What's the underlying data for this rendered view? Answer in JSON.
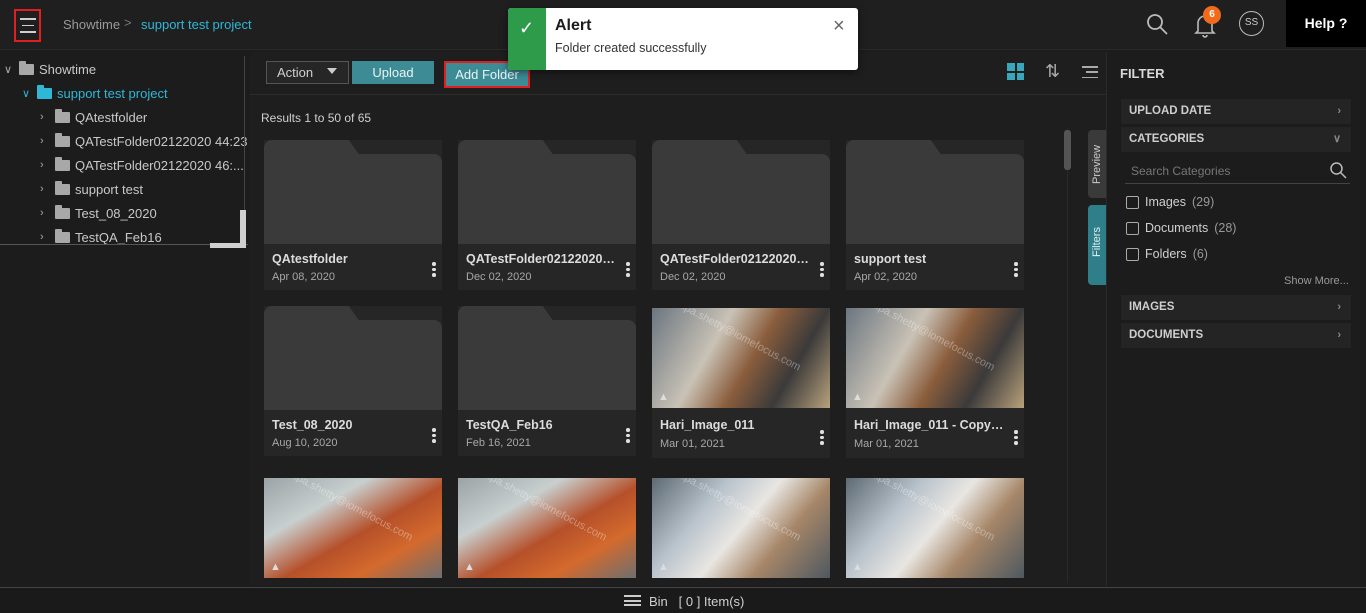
{
  "header": {
    "breadcrumb_root": "Showtime",
    "breadcrumb_sep": ">",
    "breadcrumb_current": "support test project",
    "notification_count": "6",
    "avatar_initials": "SS",
    "help_label": "Help ?"
  },
  "alert": {
    "title": "Alert",
    "message": "Folder created successfully",
    "close": "×"
  },
  "tree": {
    "root": "Showtime",
    "project": "support test project",
    "items": [
      {
        "label": "QAtestfolder"
      },
      {
        "label": "QATestFolder02122020 44:23"
      },
      {
        "label": "QATestFolder02122020 46:..."
      },
      {
        "label": "support test"
      },
      {
        "label": "Test_08_2020"
      },
      {
        "label": "TestQA_Feb16"
      }
    ]
  },
  "toolbar": {
    "action_label": "Action",
    "upload_label": "Upload",
    "add_folder_label": "Add Folder"
  },
  "results_text": "Results 1 to 50 of 65",
  "cards": [
    {
      "name": "QAtestfolder",
      "date": "Apr 08, 2020",
      "type": "folder"
    },
    {
      "name": "QATestFolder02122020 ...",
      "date": "Dec 02, 2020",
      "type": "folder"
    },
    {
      "name": "QATestFolder02122020 ...",
      "date": "Dec 02, 2020",
      "type": "folder"
    },
    {
      "name": "support test",
      "date": "Apr 02, 2020",
      "type": "folder"
    },
    {
      "name": "Test_08_2020",
      "date": "Aug 10, 2020",
      "type": "folder"
    },
    {
      "name": "TestQA_Feb16",
      "date": "Feb 16, 2021",
      "type": "folder"
    },
    {
      "name": "Hari_Image_011",
      "date": "Mar 01, 2021",
      "type": "image"
    },
    {
      "name": "Hari_Image_011 - Copy(1)",
      "date": "Mar 01, 2021",
      "type": "image"
    },
    {
      "name": "",
      "date": "",
      "type": "image"
    },
    {
      "name": "",
      "date": "",
      "type": "image"
    },
    {
      "name": "",
      "date": "",
      "type": "image"
    },
    {
      "name": "",
      "date": "",
      "type": "image"
    }
  ],
  "watermark": "shilpa.shetty@iomefocus.com",
  "side_tabs": {
    "preview": "Preview",
    "filters": "Filters"
  },
  "filter": {
    "title": "FILTER",
    "upload_date": "UPLOAD DATE",
    "categories": "CATEGORIES",
    "search_placeholder": "Search Categories",
    "options": [
      {
        "label": "Images",
        "count": "(29)"
      },
      {
        "label": "Documents",
        "count": "(28)"
      },
      {
        "label": "Folders",
        "count": "(6)"
      }
    ],
    "show_more": "Show More...",
    "images": "IMAGES",
    "documents": "DOCUMENTS"
  },
  "bin": {
    "label": "Bin",
    "count_text": "[ 0 ] Item(s)"
  },
  "colors": {
    "accent": "#2fb7d6",
    "button_teal": "#3d8b95",
    "alert_success": "#2e9b4a",
    "badge_orange": "#f26b1d",
    "highlight_red": "#e02020"
  }
}
